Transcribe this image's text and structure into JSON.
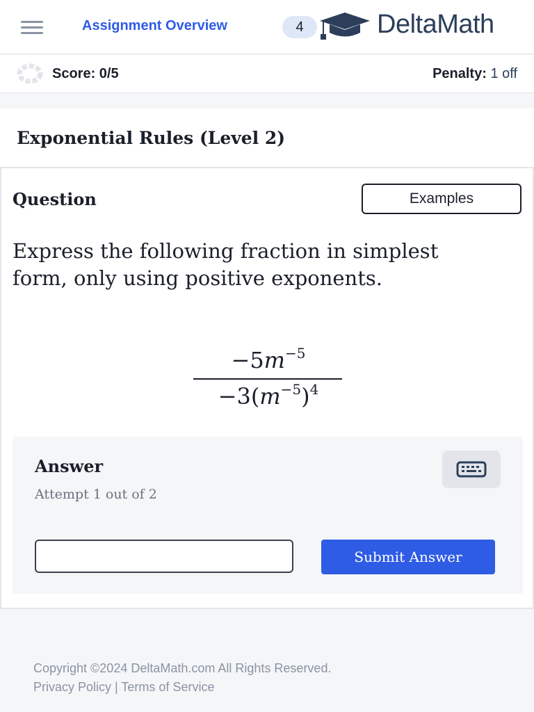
{
  "header": {
    "menu_icon": "hamburger-menu-icon",
    "assignment_link": "Assignment Overview",
    "count": "4",
    "logo_icon": "graduation-cap-icon",
    "brand": "DeltaMath"
  },
  "score_bar": {
    "spinner_icon": "loading-spinner-icon",
    "score": "Score: 0/5",
    "penalty_label": "Penalty:",
    "penalty_value": "1 off"
  },
  "problem": {
    "title": "Exponential Rules (Level 2)",
    "question_label": "Question",
    "examples_button": "Examples",
    "prompt": "Express the following fraction in simplest form, only using positive exponents.",
    "expression": {
      "numerator": {
        "prefix": "−5",
        "variable": "m",
        "exponent": "−5"
      },
      "denominator": {
        "prefix": "−3(",
        "variable": "m",
        "inner_exponent": "−5",
        "close": ")",
        "outer_exponent": "4"
      }
    }
  },
  "answer": {
    "label": "Answer",
    "attempt": "Attempt 1 out of 2",
    "keyboard_icon": "keyboard-icon",
    "input_value": "",
    "submit_button": "Submit Answer"
  },
  "footer": {
    "copyright": "Copyright ©2024 DeltaMath.com All Rights Reserved.",
    "privacy": "Privacy Policy",
    "separator": "|",
    "terms": "Terms of Service"
  },
  "colors": {
    "accent": "#2f5ce5",
    "brand": "#2c3e5a",
    "pill": "#dde7f7"
  }
}
